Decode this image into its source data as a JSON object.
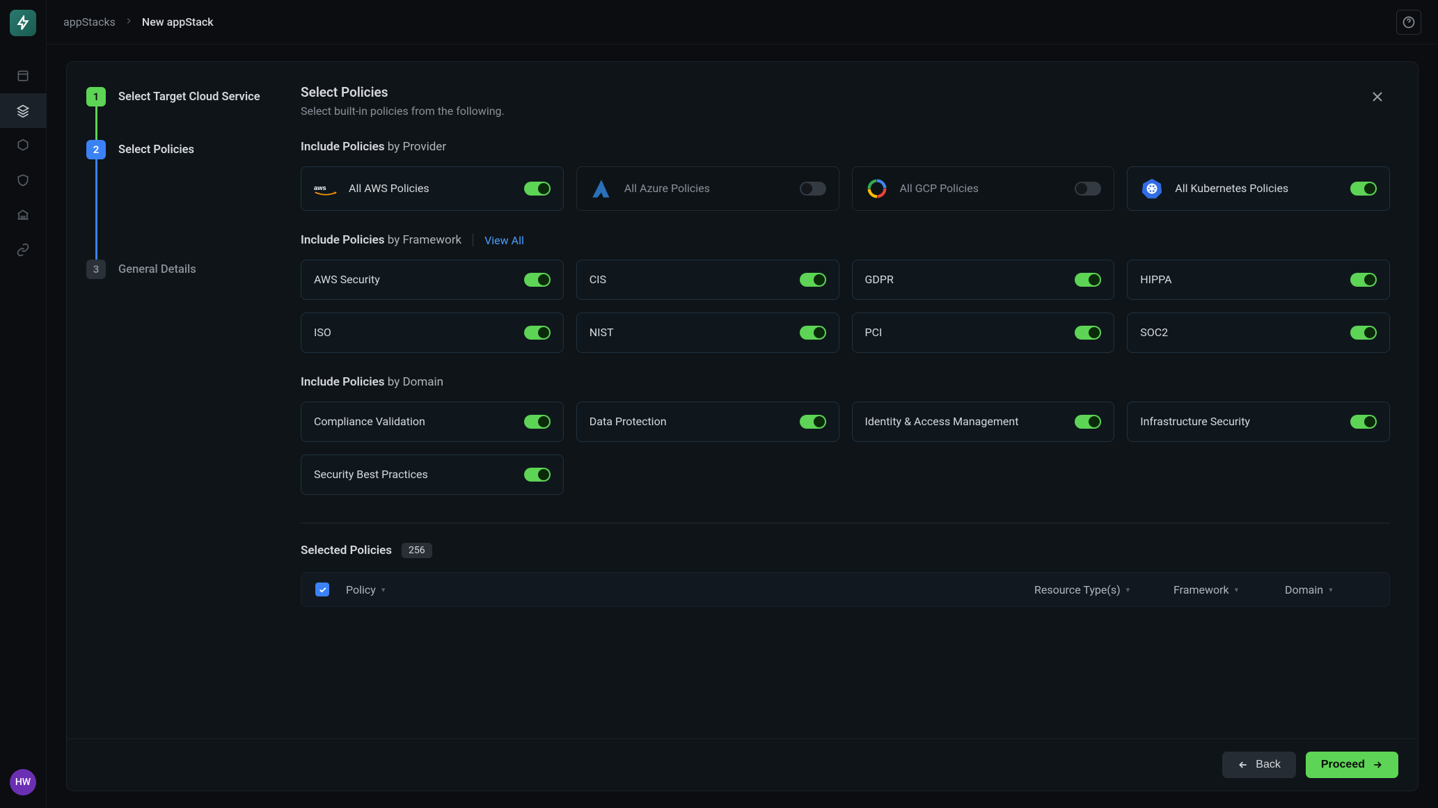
{
  "nav": {
    "avatar": "HW"
  },
  "breadcrumb": {
    "root": "appStacks",
    "current": "New appStack"
  },
  "steps": {
    "s1": {
      "num": "1",
      "label": "Select Target Cloud Service"
    },
    "s2": {
      "num": "2",
      "label": "Select Policies"
    },
    "s3": {
      "num": "3",
      "label": "General Details"
    }
  },
  "header": {
    "title": "Select Policies",
    "subtitle": "Select built-in policies from the following."
  },
  "sections": {
    "provider": {
      "strong": "Include Policies",
      "light": "by Provider"
    },
    "framework": {
      "strong": "Include Policies",
      "light": "by Framework",
      "view_all": "View All"
    },
    "domain": {
      "strong": "Include Policies",
      "light": "by Domain"
    }
  },
  "providers": {
    "aws": {
      "label": "All AWS Policies",
      "on": true
    },
    "azure": {
      "label": "All Azure Policies",
      "on": false
    },
    "gcp": {
      "label": "All GCP Policies",
      "on": false
    },
    "k8s": {
      "label": "All Kubernetes Policies",
      "on": true
    }
  },
  "frameworks": {
    "awssec": {
      "label": "AWS Security",
      "on": true
    },
    "cis": {
      "label": "CIS",
      "on": true
    },
    "gdpr": {
      "label": "GDPR",
      "on": true
    },
    "hippa": {
      "label": "HIPPA",
      "on": true
    },
    "iso": {
      "label": "ISO",
      "on": true
    },
    "nist": {
      "label": "NIST",
      "on": true
    },
    "pci": {
      "label": "PCI",
      "on": true
    },
    "soc2": {
      "label": "SOC2",
      "on": true
    }
  },
  "domains": {
    "compliance": {
      "label": "Compliance Validation",
      "on": true
    },
    "dataprot": {
      "label": "Data Protection",
      "on": true
    },
    "iam": {
      "label": "Identity & Access Management",
      "on": true
    },
    "infra": {
      "label": "Infrastructure Security",
      "on": true
    },
    "bestprac": {
      "label": "Security Best Practices",
      "on": true
    }
  },
  "selected": {
    "title": "Selected Policies",
    "count": "256"
  },
  "table": {
    "cols": {
      "policy": "Policy",
      "resource": "Resource Type(s)",
      "framework": "Framework",
      "domain": "Domain"
    }
  },
  "footer": {
    "back": "Back",
    "proceed": "Proceed"
  }
}
